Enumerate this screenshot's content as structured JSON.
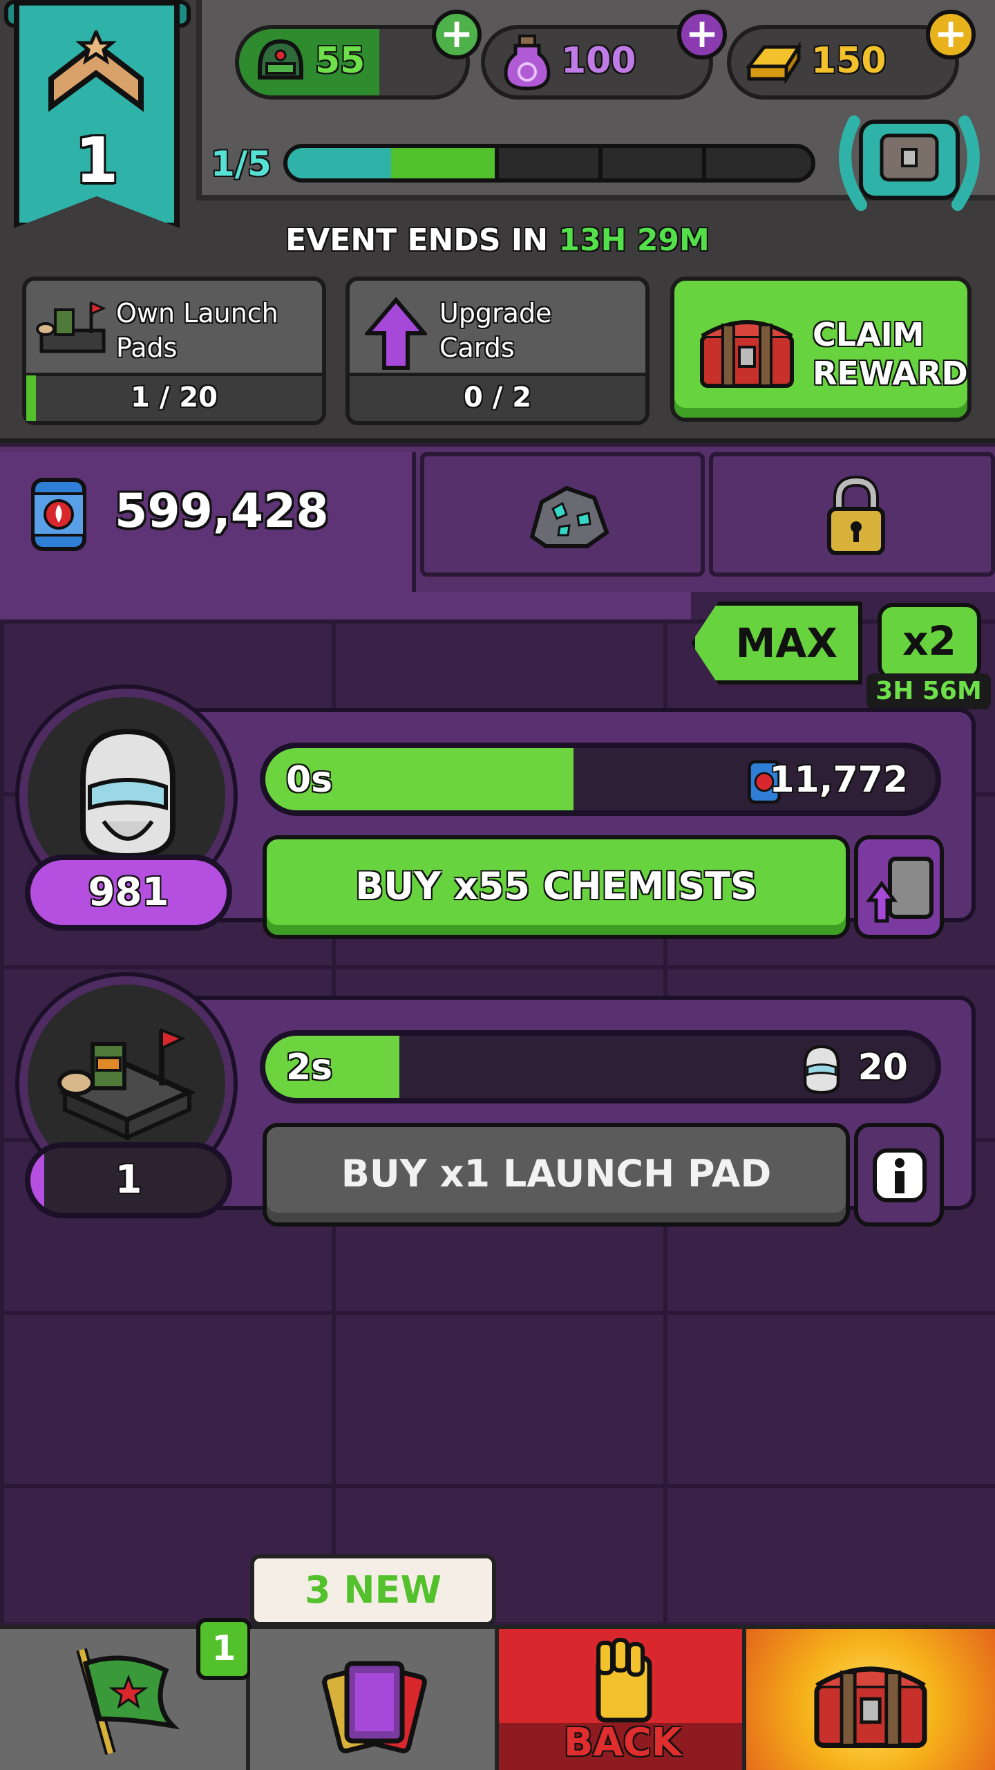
{
  "rank": {
    "level": "1"
  },
  "resources": [
    {
      "name": "helmets",
      "value": "55",
      "icon": "helmet-icon",
      "plus": "+"
    },
    {
      "name": "elixir",
      "value": "100",
      "icon": "potion-icon",
      "plus": "+"
    },
    {
      "name": "gold",
      "value": "150",
      "icon": "gold-bar-icon",
      "plus": "+"
    }
  ],
  "progress": {
    "text": "1/5",
    "segments_filled": 2,
    "segments_total": 5
  },
  "event": {
    "prefix": "EVENT ENDS IN",
    "hours": "13H",
    "minutes": "29M"
  },
  "tasks": [
    {
      "label_line1": "Own Launch",
      "label_line2": "Pads",
      "count": "1 / 20",
      "progress": 0.05,
      "icon": "launch-pad-icon"
    },
    {
      "label_line1": "Upgrade",
      "label_line2": "Cards",
      "count": "0 / 2",
      "progress": 0,
      "icon": "upgrade-arrow-icon"
    }
  ],
  "claim": {
    "line1": "CLAIM",
    "line2": "REWARD"
  },
  "currency": {
    "value": "599,428",
    "icon": "fuel-canister-icon"
  },
  "multiplier": {
    "max_label": "MAX",
    "x2_label": "x2",
    "timer": "3H 56M"
  },
  "producers": [
    {
      "name": "chemists",
      "owned": "981",
      "timer": "0s",
      "cost": "11,772",
      "cost_icon": "fuel-canister-icon",
      "bar_fill": 0.46,
      "buy_label": "BUY x55 CHEMISTS",
      "buy_enabled": true,
      "side_icon": "card-upgrade-icon"
    },
    {
      "name": "launch-pad",
      "owned": "1",
      "timer": "2s",
      "cost": "20",
      "cost_icon": "chemist-helmet-icon",
      "bar_fill": 0.2,
      "buy_label": "BUY x1 LAUNCH PAD",
      "buy_enabled": false,
      "side_icon": "info-icon"
    }
  ],
  "nav": {
    "badge": "1",
    "new_tag": "3 NEW",
    "back_label": "BACK"
  },
  "colors": {
    "accent_green": "#67d33e",
    "teal": "#2fb3a8",
    "purple": "#55306b",
    "red": "#d8282e"
  }
}
